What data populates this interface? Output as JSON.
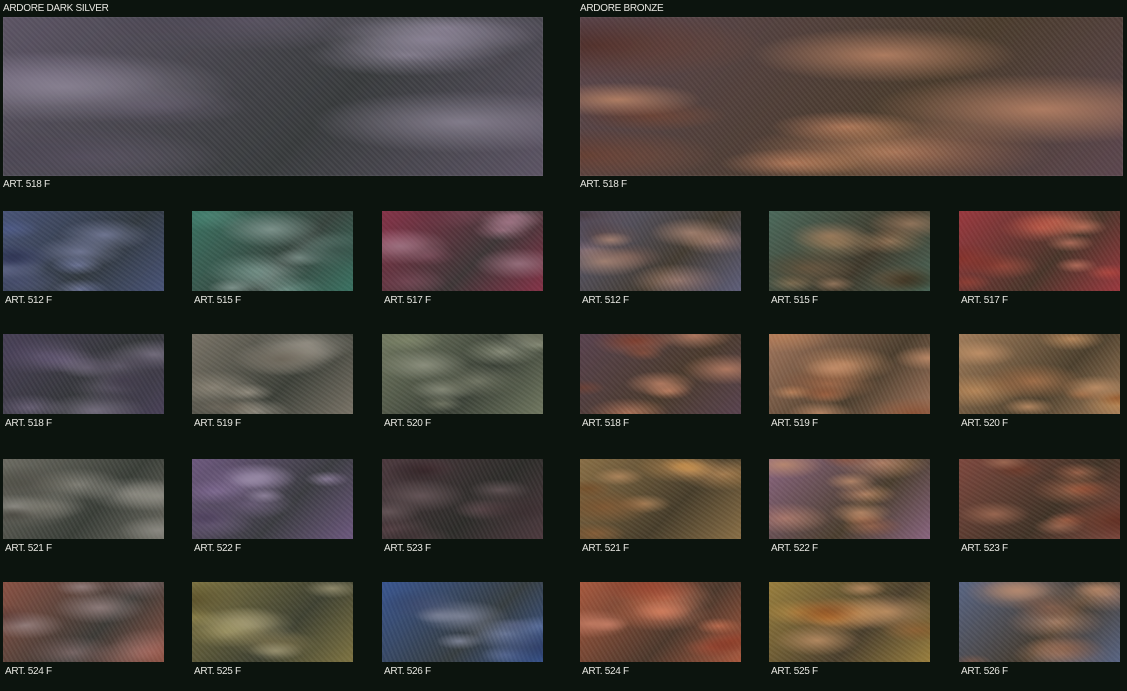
{
  "collections": [
    {
      "title": "ARDORE DARK SILVER",
      "hero": {
        "label": "ART. 518 F",
        "base": "#5e5666",
        "accent": "#8f8898"
      },
      "swatches": [
        {
          "label": "ART. 512 F",
          "base": "#4a5578",
          "accent": "#7c82a2"
        },
        {
          "label": "ART. 515 F",
          "base": "#3c7363",
          "accent": "#8ca09a"
        },
        {
          "label": "ART. 517 F",
          "base": "#853449",
          "accent": "#a07a88"
        },
        {
          "label": "ART. 518 F",
          "base": "#4a4258",
          "accent": "#827a8c"
        },
        {
          "label": "ART. 519 F",
          "base": "#7a7468",
          "accent": "#9d978c"
        },
        {
          "label": "ART. 520 F",
          "base": "#727962",
          "accent": "#979a88"
        },
        {
          "label": "ART. 521 F",
          "base": "#6d6c63",
          "accent": "#93918a"
        },
        {
          "label": "ART. 522 F",
          "base": "#6e5a7f",
          "accent": "#978aa4"
        },
        {
          "label": "ART. 523 F",
          "base": "#4e3b40",
          "accent": "#6d5c5f"
        },
        {
          "label": "ART. 524 F",
          "base": "#8a5345",
          "accent": "#9c8888"
        },
        {
          "label": "ART. 525 F",
          "base": "#7f7544",
          "accent": "#a29a78"
        },
        {
          "label": "ART. 526 F",
          "base": "#3b5790",
          "accent": "#8a8fa4"
        }
      ]
    },
    {
      "title": "ARDORE BRONZE",
      "hero": {
        "label": "ART. 518 F",
        "base": "#5d4850",
        "accent": "#c48a6a"
      },
      "swatches": [
        {
          "label": "ART. 512 F",
          "base": "#5f5f7a",
          "accent": "#b08a78"
        },
        {
          "label": "ART. 515 F",
          "base": "#4d6a5c",
          "accent": "#a28064"
        },
        {
          "label": "ART. 517 F",
          "base": "#9a3a40",
          "accent": "#c07662"
        },
        {
          "label": "ART. 518 F",
          "base": "#5a4450",
          "accent": "#c4866a"
        },
        {
          "label": "ART. 519 F",
          "base": "#a2775e",
          "accent": "#c9926e"
        },
        {
          "label": "ART. 520 F",
          "base": "#a27e5c",
          "accent": "#c9966c"
        },
        {
          "label": "ART. 521 F",
          "base": "#8a7048",
          "accent": "#b98d62"
        },
        {
          "label": "ART. 522 F",
          "base": "#8a6680",
          "accent": "#c3906e"
        },
        {
          "label": "ART. 523 F",
          "base": "#7e4a40",
          "accent": "#a77058"
        },
        {
          "label": "ART. 524 F",
          "base": "#a85a40",
          "accent": "#c98068"
        },
        {
          "label": "ART. 525 F",
          "base": "#9a8040",
          "accent": "#c4946a"
        },
        {
          "label": "ART. 526 F",
          "base": "#5a6684",
          "accent": "#b68a70"
        }
      ]
    }
  ]
}
